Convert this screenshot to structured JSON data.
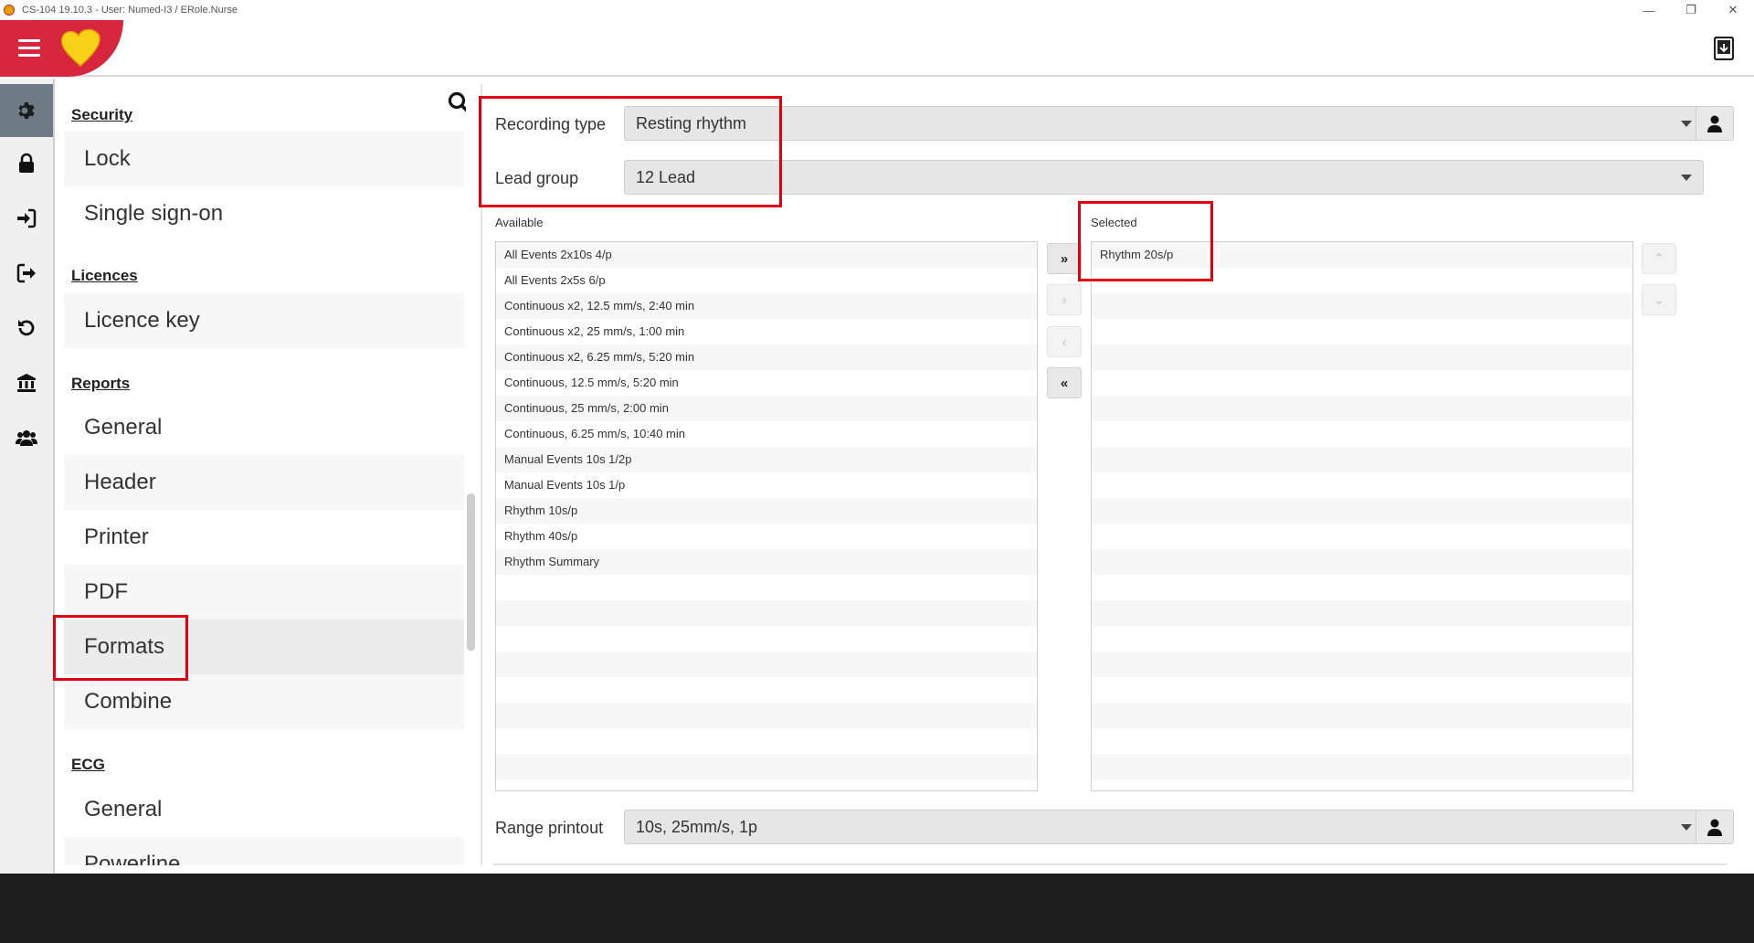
{
  "window": {
    "title": "CS-104 19.10.3 - User: Numed-I3 / ERole.Nurse",
    "controls": [
      "—",
      "❐",
      "✕"
    ]
  },
  "header": {
    "menu_icon": "hamburger-icon",
    "logo_icon": "heart-logo-icon",
    "right_icon": "tablet-icon"
  },
  "rail": [
    "gear-icon",
    "lock-icon",
    "sign-in-icon",
    "sign-out-icon",
    "undo-icon",
    "institution-icon",
    "users-icon"
  ],
  "nav": {
    "sections": {
      "security": "Security",
      "licences": "Licences",
      "reports": "Reports",
      "ecg": "ECG"
    },
    "items": {
      "lock": "Lock",
      "sso": "Single sign-on",
      "licence_key": "Licence key",
      "general": "General",
      "header": "Header",
      "printer": "Printer",
      "pdf": "PDF",
      "formats": "Formats",
      "combine": "Combine",
      "ecg_general": "General",
      "powerline": "Powerline"
    }
  },
  "form": {
    "recording_type_label": "Recording type",
    "recording_type_value": "Resting rhythm",
    "lead_group_label": "Lead group",
    "lead_group_value": "12 Lead",
    "available_label": "Available",
    "selected_label": "Selected",
    "available": [
      "All Events 2x10s 4/p",
      "All Events 2x5s 6/p",
      "Continuous x2, 12.5 mm/s, 2:40 min",
      "Continuous x2, 25 mm/s, 1:00 min",
      "Continuous x2, 6.25 mm/s, 5:20 min",
      "Continuous, 12.5 mm/s, 5:20 min",
      "Continuous, 25 mm/s, 2:00 min",
      "Continuous, 6.25 mm/s, 10:40 min",
      "Manual Events 10s 1/2p",
      "Manual Events 10s 1/p",
      "Rhythm 10s/p",
      "Rhythm 40s/p",
      "Rhythm Summary"
    ],
    "selected": [
      "Rhythm 20s/p"
    ],
    "move_buttons": {
      "add_all": "»",
      "add": "›",
      "remove": "‹",
      "remove_all": "«"
    },
    "order_buttons": {
      "up": "⌃",
      "down": "⌄"
    },
    "range_printout_label": "Range printout",
    "range_printout_value": "10s, 25mm/s, 1p"
  }
}
